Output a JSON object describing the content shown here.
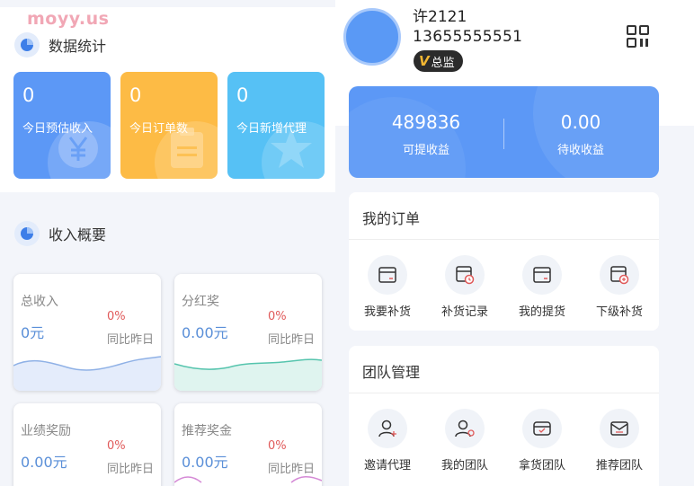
{
  "watermark": "moyy.us",
  "data_stats": {
    "title": "数据统计",
    "tiles": [
      {
        "value": "0",
        "label": "今日预估收入",
        "color": "#5c98f6",
        "icon": "yen-icon"
      },
      {
        "value": "0",
        "label": "今日订单数",
        "color": "#fdbb45",
        "icon": "clipboard-icon"
      },
      {
        "value": "0",
        "label": "今日新增代理",
        "color": "#56c1f5",
        "icon": "star-icon"
      }
    ]
  },
  "income_overview": {
    "title": "收入概要",
    "cards": [
      {
        "title": "总收入",
        "value": "0元",
        "pct": "0%",
        "compare": "同比昨日",
        "color": "#8fb1e6"
      },
      {
        "title": "分红奖",
        "value": "0.00元",
        "pct": "0%",
        "compare": "同比昨日",
        "color": "#55c4ad"
      },
      {
        "title": "业绩奖励",
        "value": "0.00元",
        "pct": "0%",
        "compare": "同比昨日",
        "color": "#f0a64a"
      },
      {
        "title": "推荐奖金",
        "value": "0.00元",
        "pct": "0%",
        "compare": "同比昨日",
        "color": "#d58ad6"
      }
    ]
  },
  "profile": {
    "name": "许2121",
    "phone": "13655555551",
    "badge_v": "V",
    "badge": "总监"
  },
  "earnings": {
    "withdrawable_value": "489836",
    "withdrawable_label": "可提收益",
    "pending_value": "0.00",
    "pending_label": "待收收益"
  },
  "my_orders": {
    "title": "我的订单",
    "items": [
      {
        "label": "我要补货",
        "icon": "restock-icon"
      },
      {
        "label": "补货记录",
        "icon": "restock-record-icon"
      },
      {
        "label": "我的提货",
        "icon": "pickup-icon"
      },
      {
        "label": "下级补货",
        "icon": "sub-restock-icon"
      }
    ]
  },
  "team": {
    "title": "团队管理",
    "items": [
      {
        "label": "邀请代理",
        "icon": "invite-agent-icon"
      },
      {
        "label": "我的团队",
        "icon": "my-team-icon"
      },
      {
        "label": "拿货团队",
        "icon": "purchase-team-icon"
      },
      {
        "label": "推荐团队",
        "icon": "referral-team-icon"
      }
    ]
  }
}
